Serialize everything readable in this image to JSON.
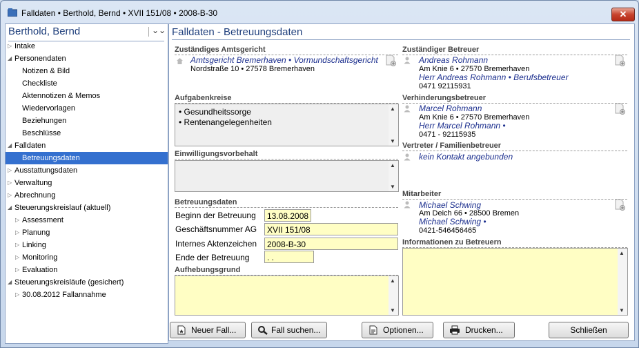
{
  "window": {
    "title": "Falldaten  •  Berthold, Bernd  •  XVII 151/08  •  2008-B-30",
    "close_label": "✕"
  },
  "sidebar": {
    "user_name": "Berthold, Bernd",
    "items": [
      {
        "label": "Intake",
        "level": 0,
        "arrow": "▷"
      },
      {
        "label": "Personendaten",
        "level": 0,
        "arrow": "◢"
      },
      {
        "label": "Notizen & Bild",
        "level": 1,
        "arrow": ""
      },
      {
        "label": "Checkliste",
        "level": 1,
        "arrow": ""
      },
      {
        "label": "Aktennotizen & Memos",
        "level": 1,
        "arrow": ""
      },
      {
        "label": "Wiedervorlagen",
        "level": 1,
        "arrow": ""
      },
      {
        "label": "Beziehungen",
        "level": 1,
        "arrow": ""
      },
      {
        "label": "Beschlüsse",
        "level": 1,
        "arrow": ""
      },
      {
        "label": "Falldaten",
        "level": 0,
        "arrow": "◢"
      },
      {
        "label": "Betreuungsdaten",
        "level": 1,
        "arrow": "",
        "selected": true
      },
      {
        "label": "Ausstattungsdaten",
        "level": 0,
        "arrow": "▷"
      },
      {
        "label": "Verwaltung",
        "level": 0,
        "arrow": "▷"
      },
      {
        "label": "Abrechnung",
        "level": 0,
        "arrow": "▷"
      },
      {
        "label": "Steuerungskreislauf (aktuell)",
        "level": 0,
        "arrow": "◢"
      },
      {
        "label": "Assessment",
        "level": 1,
        "arrow": "▷"
      },
      {
        "label": "Planung",
        "level": 1,
        "arrow": "▷"
      },
      {
        "label": "Linking",
        "level": 1,
        "arrow": "▷"
      },
      {
        "label": "Monitoring",
        "level": 1,
        "arrow": "▷"
      },
      {
        "label": "Evaluation",
        "level": 1,
        "arrow": "▷"
      },
      {
        "label": "Steuerungskreisläufe (gesichert)",
        "level": 0,
        "arrow": "◢"
      },
      {
        "label": "30.08.2012 Fallannahme",
        "level": 1,
        "arrow": "▷"
      }
    ]
  },
  "page": {
    "title": "Falldaten - Betreuungsdaten"
  },
  "amtsgericht": {
    "heading": "Zuständiges Amtsgericht",
    "name": "Amtsgericht Bremerhaven • Vormundschaftsgericht",
    "address": "Nordstraße 10 • 27578 Bremerhaven"
  },
  "aufgabenkreise": {
    "heading": "Aufgabenkreise",
    "items": [
      "• Gesundheitssorge",
      "• Rentenangelegenheiten"
    ]
  },
  "einwilligung": {
    "heading": "Einwilligungsvorbehalt"
  },
  "betreuungsdaten": {
    "heading": "Betreuungsdaten",
    "beginn_label": "Beginn der Betreuung",
    "beginn_value": "13.08.2008",
    "gnr_label": "Geschäftsnummer AG",
    "gnr_value": "XVII 151/08",
    "az_label": "Internes Aktenzeichen",
    "az_value": "2008-B-30",
    "ende_label": "Ende der Betreuung",
    "ende_value": " .  ."
  },
  "aufhebung": {
    "heading": "Aufhebungsgrund"
  },
  "betreuer": {
    "heading": "Zuständiger Betreuer",
    "name": "Andreas Rohmann",
    "address": "Am Knie 6 • 27570 Bremerhaven",
    "role": "Herr Andreas Rohmann • Berufsbetreuer",
    "phone": "0471 92115931"
  },
  "verhinderung": {
    "heading": "Verhinderungsbetreuer",
    "name": "Marcel Rohmann",
    "address": "Am Knie 6 • 27570 Bremerhaven",
    "role": "Herr Marcel Rohmann •",
    "phone": "0471 - 92115935"
  },
  "vertreter": {
    "heading": "Vertreter / Familienbetreuer",
    "value": "kein Kontakt angebunden"
  },
  "mitarbeiter": {
    "heading": "Mitarbeiter",
    "name": "Michael Schwing",
    "address": "Am Deich 66 • 28500 Bremen",
    "role": "Michael Schwing  •",
    "phone": "0421-546456465"
  },
  "informationen": {
    "heading": "Informationen zu Betreuern"
  },
  "buttons": {
    "neuer_fall": "Neuer Fall...",
    "fall_suchen": "Fall suchen...",
    "optionen": "Optionen...",
    "drucken": "Drucken...",
    "schliessen": "Schließen"
  },
  "colors": {
    "accent": "#1f3f7c",
    "selection": "#3470cf",
    "field_yellow": "#fffec4",
    "link": "#1c2f8e"
  }
}
